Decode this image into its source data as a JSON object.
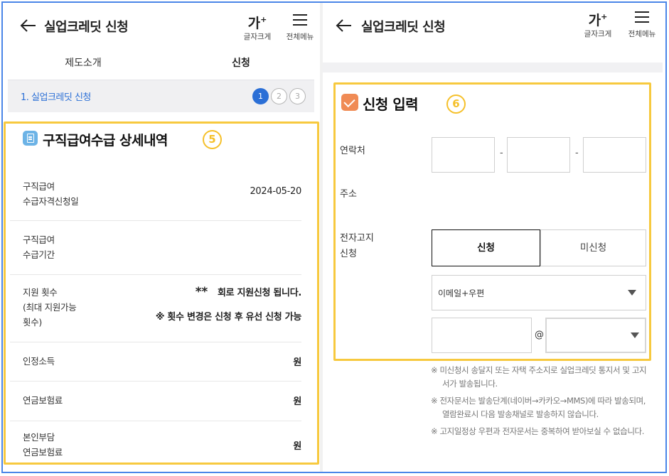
{
  "header": {
    "back_icon": "arrow-left-icon",
    "title": "실업크레딧 신청",
    "font_size_glyph": "가",
    "font_size_sup": "+",
    "font_size_label": "글자크게",
    "menu_icon": "hamburger-icon",
    "menu_label": "전체메뉴"
  },
  "tabs": [
    {
      "label": "제도소개",
      "active": false
    },
    {
      "label": "신청",
      "active": true
    }
  ],
  "stepper": {
    "label": "1. 실업크레딧 신청",
    "steps": [
      "1",
      "2",
      "3"
    ],
    "current": "1"
  },
  "callouts": {
    "five": "5",
    "six": "6"
  },
  "left": {
    "section_icon": "document-icon",
    "section_title": "구직급여수급 상세내역",
    "rows": [
      {
        "label_1": "구직급여",
        "label_2": "수급자격신청일",
        "value": "2024-05-20"
      },
      {
        "label_1": "구직급여",
        "label_2": "수급기간",
        "value": ""
      },
      {
        "label_1": "지원 횟수",
        "label_2": "(최대 지원가능",
        "label_3": "횟수)",
        "value_stars": "**",
        "value_1": "회로 지원신청 됩니다.",
        "value_2": "※ 횟수 변경은 신청 후 유선 신청 가능"
      },
      {
        "label_1": "인정소득",
        "value": "원"
      },
      {
        "label_1": "연금보험료",
        "value": "원"
      },
      {
        "label_1": "본인부담",
        "label_2": "연금보험료",
        "value": "원"
      }
    ]
  },
  "right": {
    "section_icon": "checkbox-checked-icon",
    "section_title": "신청 입력",
    "phone_label": "연락처",
    "phone_sep": "-",
    "address_label": "주소",
    "notice_label_1": "전자고지",
    "notice_label_2": "신청",
    "notice_on": "신청",
    "notice_off": "미신청",
    "method_selected": "이메일+우편",
    "email_at": "@",
    "email_domain_selected": "",
    "notes": [
      "※ 미신청시 송달지 또는 자택 주소지로 실업크레딧 통지서 및 고지서가 발송됩니다.",
      "※ 전자문서는 발송단계(네이버→카카오→MMS)에 따라 발송되며, 열람완료시 다음 발송채널로 발송하지 않습니다.",
      "※ 고지일정상 우편과 전자문서는 중복하여 받아보실 수 없습니다."
    ]
  },
  "colors": {
    "frame": "#4a86e8",
    "accent_blue": "#2b6fd6",
    "highlight_yellow": "#f7c93e",
    "check_orange": "#f08b55"
  }
}
